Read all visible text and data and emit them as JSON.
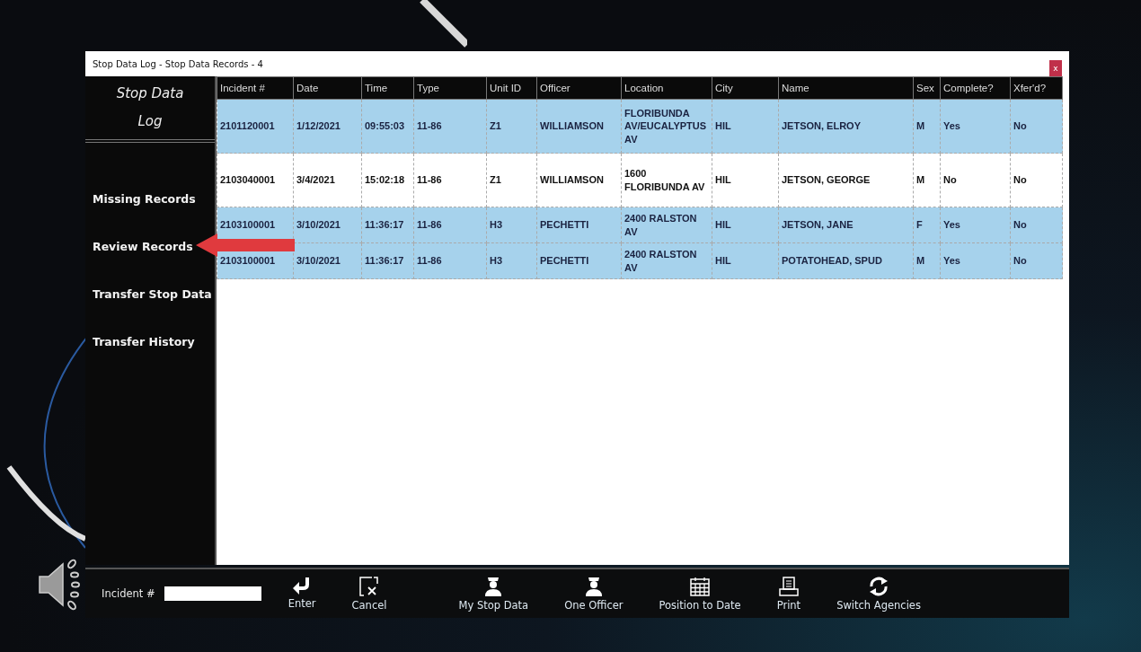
{
  "window": {
    "title": "Stop Data Log - Stop Data Records - 4",
    "close": "x"
  },
  "sidebar": {
    "title": "Stop Data Log",
    "items": [
      {
        "label": "Missing Records"
      },
      {
        "label": "Review Records"
      },
      {
        "label": "Transfer Stop Data"
      },
      {
        "label": "Transfer History"
      }
    ]
  },
  "table": {
    "columns": [
      "Incident #",
      "Date",
      "Time",
      "Type",
      "Unit ID",
      "Officer",
      "Location",
      "City",
      "Name",
      "Sex",
      "Complete?",
      "Xfer'd?"
    ],
    "rows": [
      {
        "selected": true,
        "cells": [
          "2101120001",
          "1/12/2021",
          "09:55:03",
          "11-86",
          "Z1",
          "WILLIAMSON",
          "FLORIBUNDA AV/EUCALYPTUS AV",
          "HIL",
          "JETSON, ELROY",
          "M",
          "Yes",
          "No"
        ]
      },
      {
        "selected": false,
        "cells": [
          "2103040001",
          "3/4/2021",
          "15:02:18",
          "11-86",
          "Z1",
          "WILLIAMSON",
          "1600 FLORIBUNDA AV",
          "HIL",
          "JETSON, GEORGE",
          "M",
          "No",
          "No"
        ]
      },
      {
        "selected": true,
        "cells": [
          "2103100001",
          "3/10/2021",
          "11:36:17",
          "11-86",
          "H3",
          "PECHETTI",
          "2400 RALSTON AV",
          "HIL",
          "JETSON, JANE",
          "F",
          "Yes",
          "No"
        ]
      },
      {
        "selected": true,
        "cells": [
          "2103100001",
          "3/10/2021",
          "11:36:17",
          "11-86",
          "H3",
          "PECHETTI",
          "2400 RALSTON AV",
          "HIL",
          "POTATOHEAD, SPUD",
          "M",
          "Yes",
          "No"
        ]
      }
    ]
  },
  "toolbar": {
    "incident_label": "Incident #",
    "buttons": [
      {
        "kind": "enter",
        "label": "Enter"
      },
      {
        "kind": "cancel",
        "label": "Cancel"
      },
      {
        "kind": "officer",
        "label": "My Stop Data"
      },
      {
        "kind": "officer",
        "label": "One Officer"
      },
      {
        "kind": "calendar",
        "label": "Position to Date"
      },
      {
        "kind": "print",
        "label": "Print"
      },
      {
        "kind": "refresh",
        "label": "Switch Agencies"
      }
    ]
  }
}
